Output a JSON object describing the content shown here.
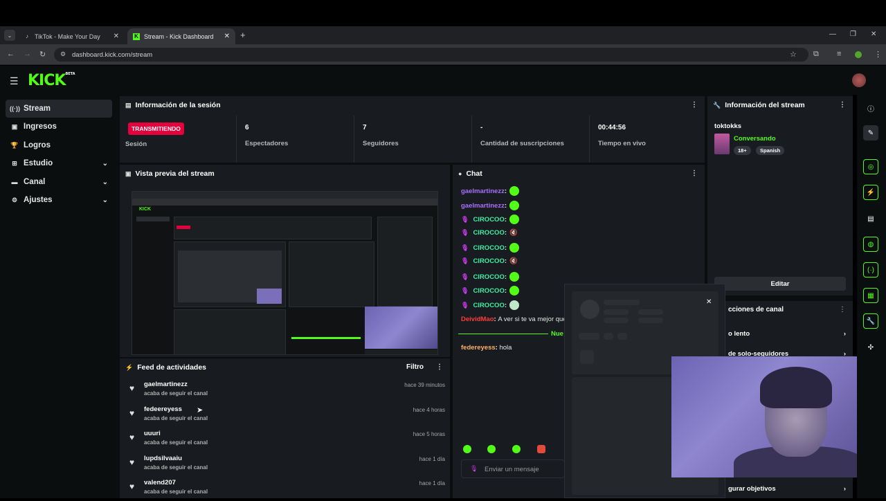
{
  "browser": {
    "tabs": [
      {
        "title": "TikTok - Make Your Day",
        "icon": "tiktok-icon"
      },
      {
        "title": "Stream - Kick Dashboard",
        "icon": "kick-icon"
      }
    ],
    "url": "dashboard.kick.com/stream"
  },
  "header": {
    "logo": "KICK",
    "logo_sup": "BETA"
  },
  "sidebar": {
    "items": [
      {
        "label": "Stream",
        "icon": "broadcast-icon"
      },
      {
        "label": "Ingresos",
        "icon": "wallet-icon"
      },
      {
        "label": "Logros",
        "icon": "trophy-icon"
      },
      {
        "label": "Estudio",
        "icon": "studio-icon"
      },
      {
        "label": "Canal",
        "icon": "channel-icon"
      },
      {
        "label": "Ajustes",
        "icon": "gear-icon"
      }
    ]
  },
  "session": {
    "title": "Información de la sesión",
    "badge": "TRANSMITIENDO",
    "badge_label": "Sesión",
    "stats": [
      {
        "value": "6",
        "label": "Espectadores"
      },
      {
        "value": "7",
        "label": "Seguidores"
      },
      {
        "value": "-",
        "label": "Cantidad de suscripciones"
      },
      {
        "value": "00:44:56",
        "label": "Tiempo en vivo"
      }
    ]
  },
  "preview": {
    "title": "Vista previa del stream"
  },
  "chat": {
    "title": "Chat",
    "messages": [
      {
        "user": "gaelmartinezz",
        "color": "#a970ff",
        "text": ""
      },
      {
        "user": "gaelmartinezz",
        "color": "#a970ff",
        "text": ""
      },
      {
        "user": "CIROCOO",
        "color": "#3cf0a8",
        "text": ""
      },
      {
        "user": "CIROCOO",
        "color": "#3cf0a8",
        "text": ""
      },
      {
        "user": "CIROCOO",
        "color": "#3cf0a8",
        "text": ""
      },
      {
        "user": "CIROCOO",
        "color": "#3cf0a8",
        "text": ""
      },
      {
        "user": "CIROCOO",
        "color": "#3cf0a8",
        "text": ""
      },
      {
        "user": "CIROCOO",
        "color": "#3cf0a8",
        "text": ""
      },
      {
        "user": "CIROCOO",
        "color": "#3cf0a8",
        "text": ""
      },
      {
        "user": "DeividMao",
        "color": "#ff3b3b",
        "text": "A ver si te va mejor que"
      },
      {
        "user": "federeyess",
        "color": "#ffb36b",
        "text": "hola"
      }
    ],
    "new_label": "Nue",
    "placeholder": "Enviar un mensaje"
  },
  "stream_info": {
    "title": "Información del stream",
    "channel": "toktokks",
    "category": "Conversando",
    "tags": [
      "18+",
      "Spanish"
    ],
    "edit_label": "Editar"
  },
  "channel_actions": {
    "title": "cciones de canal",
    "items": [
      "o lento",
      "de solo-seguidores",
      "gurar objetivos"
    ]
  },
  "feed": {
    "title": "Feed de actividades",
    "filter_label": "Filtro",
    "items": [
      {
        "user": "gaelmartinezz",
        "action": "acaba de seguir el canal",
        "time": "hace 39 minutos"
      },
      {
        "user": "fedeereyess",
        "action": "acaba de seguir el canal",
        "time": "hace 4 horas"
      },
      {
        "user": "uuuri",
        "action": "acaba de seguir el canal",
        "time": "hace 5 horas"
      },
      {
        "user": "lupdsilvaaiu",
        "action": "acaba de seguir el canal",
        "time": "hace 1 día"
      },
      {
        "user": "valend207",
        "action": "acaba de seguir el canal",
        "time": "hace 1 día"
      }
    ]
  },
  "colors": {
    "accent": "#53fc18",
    "live": "#e3003d",
    "panel": "#181b1f"
  }
}
